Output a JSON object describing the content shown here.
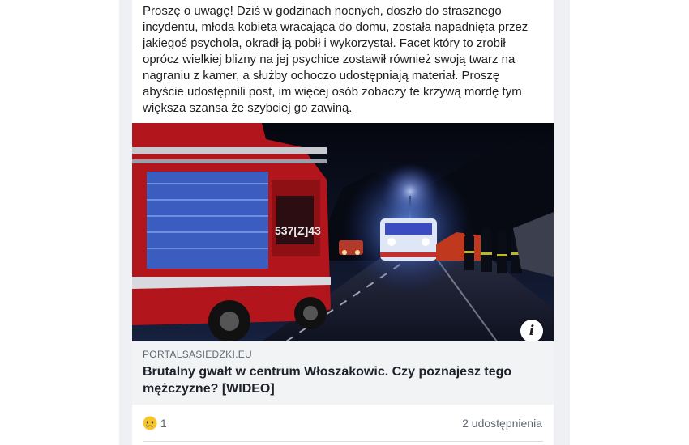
{
  "post": {
    "text": "Proszę o uwagę! Dziś w godzinach nocnych, doszło do strasznego incydentu, młoda kobieta wracająca do domu, została napadnięta przez jakiegoś psychola, okradł ją pobił i wykorzystał. Facet który to zrobił oprócz wielkiej blizny na jej psychice zostawił również swoją twarz na nagraniu z kamer, a służby ochoczo udostępniają materiał. Proszę abyście udostępnili post, im więcej osób zobaczy te krzywą mordę tym większa szansa że szybciej go zawiną."
  },
  "link_preview": {
    "image_icon": "info-icon",
    "truck_number": "537[Z]43",
    "domain": "PORTALSASIEDZKI.EU",
    "headline": "Brutalny gwałt w centrum Włoszakowic. Czy poznajesz tego mężczyzne? [WIDEO]"
  },
  "engagement": {
    "reaction_icon": "sad-reaction-icon",
    "reaction_count": "1",
    "shares": "2 udostępnienia"
  }
}
